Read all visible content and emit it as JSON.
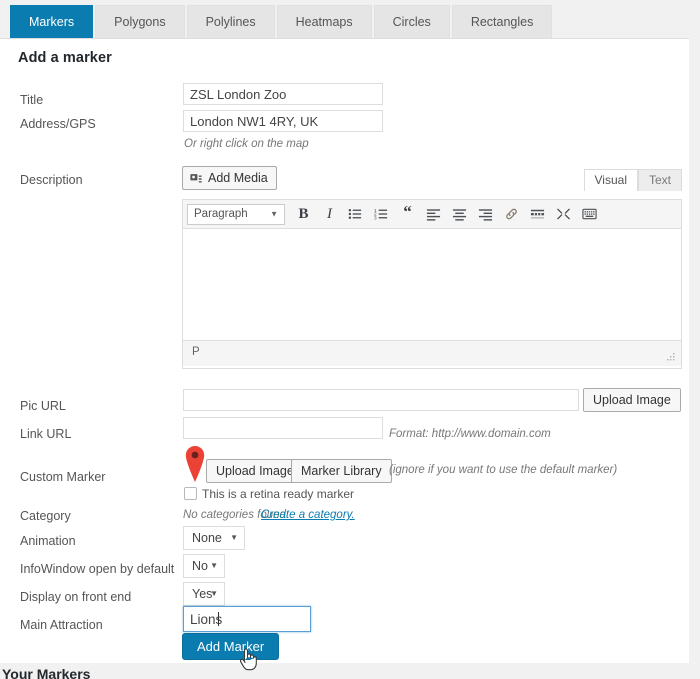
{
  "tabs": [
    {
      "label": "Markers",
      "active": true
    },
    {
      "label": "Polygons",
      "active": false
    },
    {
      "label": "Polylines",
      "active": false
    },
    {
      "label": "Heatmaps",
      "active": false
    },
    {
      "label": "Circles",
      "active": false
    },
    {
      "label": "Rectangles",
      "active": false
    }
  ],
  "panel": {
    "title": "Add a marker"
  },
  "form": {
    "title": {
      "label": "Title",
      "value": "ZSL London Zoo",
      "placeholder": ""
    },
    "address": {
      "label": "Address/GPS",
      "value": "London NW1 4RY, UK",
      "placeholder": "",
      "hint": "Or right click on the map"
    },
    "description": {
      "label": "Description"
    },
    "pic_url": {
      "label": "Pic URL",
      "value": "",
      "placeholder": "",
      "button": "Upload Image"
    },
    "link_url": {
      "label": "Link URL",
      "value": "",
      "placeholder": "",
      "hint": "Format: http://www.domain.com"
    },
    "custom_marker": {
      "label": "Custom Marker",
      "upload_button": "Upload Image",
      "library_button": "Marker Library",
      "hint": "(ignore if you want to use the default marker)",
      "retina_label": "This is a retina ready marker",
      "retina_checked": false,
      "pin_color": "#ea4335"
    },
    "category": {
      "label": "Category",
      "empty_text": "No categories found",
      "link_text": "Create a category."
    },
    "animation": {
      "label": "Animation",
      "value": "None"
    },
    "infowindow": {
      "label": "InfoWindow open by default",
      "value": "No"
    },
    "display_front_end": {
      "label": "Display on front end",
      "value": "Yes"
    },
    "main_attraction": {
      "label": "Main Attraction",
      "value": "Lions",
      "placeholder": "",
      "focused": true
    },
    "submit": {
      "label": "Add Marker"
    }
  },
  "editor": {
    "add_media": "Add Media",
    "visual_tab": "Visual",
    "text_tab": "Text",
    "active_tab": "Visual",
    "format_select": "Paragraph",
    "content": "",
    "status_path": "P",
    "toolbar_buttons": [
      "bold-icon",
      "italic-icon",
      "bullet-list-icon",
      "numbered-list-icon",
      "blockquote-icon",
      "align-left-icon",
      "align-center-icon",
      "align-right-icon",
      "link-icon",
      "read-more-icon",
      "fullscreen-icon",
      "toolbar-toggle-icon"
    ]
  },
  "bottom": {
    "heading": "Your Markers"
  },
  "colors": {
    "accent": "#0b7cb0",
    "page_bg": "#f1f1f1",
    "panel_bg": "#ffffff",
    "marker_red": "#ea4335",
    "link": "#0b7cb0"
  }
}
